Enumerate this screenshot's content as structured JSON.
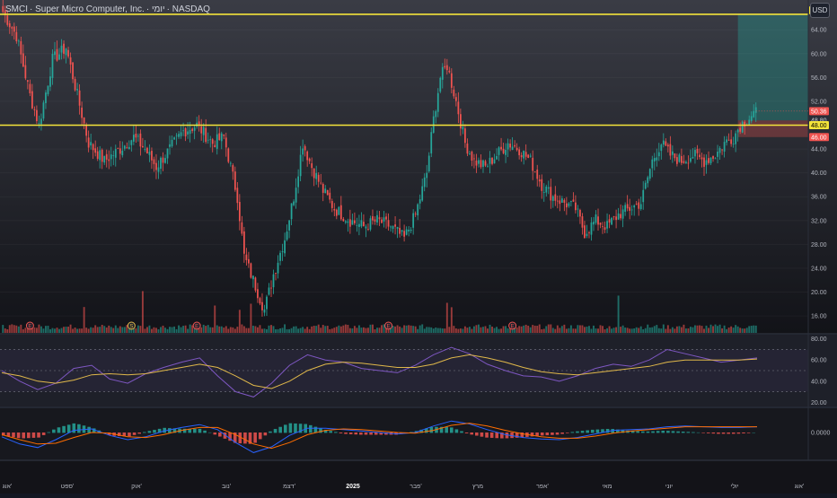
{
  "header": {
    "symbol": "SMCI",
    "company": "Super Micro Computer, Inc.",
    "interval": "יומי",
    "exchange": "NASDAQ",
    "currency_button": "USD"
  },
  "colors": {
    "background": "#131722",
    "up": "#26a69a",
    "down": "#ef5350",
    "level_line": "#f4e43a",
    "rsi_line": "#7e57c2",
    "rsi_ma": "#e0b84a",
    "macd_line": "#2962ff",
    "signal_line": "#ff6d00"
  },
  "chart_data": [
    {
      "type": "candlestick",
      "panel": "price",
      "y_ticks": [
        "64.00",
        "60.00",
        "56.00",
        "52.00",
        "44.00",
        "40.00",
        "36.00",
        "32.00",
        "28.00",
        "24.00",
        "20.00",
        "16.00"
      ],
      "ylim": [
        13,
        69
      ],
      "x_tick_labels": [
        "אוג'",
        "ספט'",
        "אוק'",
        "נוב'",
        "דצמ'",
        "2025",
        "פבר'",
        "מרץ",
        "אפר'",
        "מאי",
        "יוני",
        "יולי",
        "אוג'"
      ],
      "level_lines": [
        {
          "price": 66.6,
          "label": "66.60"
        },
        {
          "price": 48.0,
          "label": "48.00"
        }
      ],
      "price_badges": [
        {
          "label": "66.60",
          "price": 66.6
        },
        {
          "label": "50.36",
          "price": 50.36
        },
        {
          "label": "48.80",
          "price": 48.8
        },
        {
          "label": "48.00",
          "price": 48.0
        },
        {
          "label": "46.00",
          "price": 46.0
        }
      ],
      "position_tool": {
        "entry": 48.8,
        "target": 66.6,
        "stop": 46.0
      },
      "event_markers": [
        "E",
        "S",
        "E",
        "E",
        "E"
      ],
      "close_path": [
        [
          0,
          67
        ],
        [
          6,
          63
        ],
        [
          12,
          53
        ],
        [
          16,
          48
        ],
        [
          22,
          59
        ],
        [
          28,
          61
        ],
        [
          33,
          53
        ],
        [
          38,
          45
        ],
        [
          45,
          42
        ],
        [
          52,
          44
        ],
        [
          58,
          46
        ],
        [
          63,
          44
        ],
        [
          68,
          41
        ],
        [
          74,
          44
        ],
        [
          80,
          47
        ],
        [
          86,
          48
        ],
        [
          93,
          45
        ],
        [
          98,
          46
        ],
        [
          104,
          36
        ],
        [
          107,
          26
        ],
        [
          111,
          22
        ],
        [
          116,
          17
        ],
        [
          120,
          23
        ],
        [
          125,
          29
        ],
        [
          129,
          36
        ],
        [
          133,
          45
        ],
        [
          137,
          41
        ],
        [
          142,
          37
        ],
        [
          147,
          34
        ],
        [
          154,
          32
        ],
        [
          160,
          31
        ],
        [
          166,
          32
        ],
        [
          172,
          31
        ],
        [
          178,
          29
        ],
        [
          183,
          33
        ],
        [
          188,
          40
        ],
        [
          191,
          49
        ],
        [
          194,
          56
        ],
        [
          197,
          58
        ],
        [
          201,
          52
        ],
        [
          205,
          45
        ],
        [
          209,
          42
        ],
        [
          214,
          41
        ],
        [
          219,
          43
        ],
        [
          224,
          45
        ],
        [
          229,
          44
        ],
        [
          234,
          42
        ],
        [
          239,
          38
        ],
        [
          244,
          36
        ],
        [
          249,
          35
        ],
        [
          254,
          34
        ],
        [
          258,
          30
        ],
        [
          263,
          32
        ],
        [
          268,
          31
        ],
        [
          273,
          33
        ],
        [
          278,
          34
        ],
        [
          283,
          35
        ],
        [
          288,
          42
        ],
        [
          292,
          45
        ],
        [
          296,
          43
        ],
        [
          301,
          42
        ],
        [
          306,
          43
        ],
        [
          311,
          42
        ],
        [
          316,
          43
        ],
        [
          320,
          45
        ],
        [
          324,
          46
        ],
        [
          327,
          48
        ],
        [
          330,
          49
        ],
        [
          333,
          50
        ]
      ],
      "volume_note": "relative volume bars"
    },
    {
      "type": "line",
      "panel": "RSI",
      "y_ticks": [
        "80.00",
        "60.00",
        "40.00",
        "20.00"
      ],
      "ylim": [
        16,
        84
      ],
      "series": [
        {
          "role": "rsi",
          "values": [
            50,
            40,
            32,
            38,
            52,
            55,
            42,
            38,
            47,
            53,
            58,
            62,
            45,
            30,
            25,
            38,
            55,
            65,
            60,
            58,
            52,
            50,
            48,
            55,
            65,
            72,
            66,
            56,
            50,
            45,
            44,
            40,
            45,
            52,
            56,
            54,
            60,
            70,
            66,
            62,
            58,
            60,
            62
          ]
        },
        {
          "role": "rsi-ma",
          "values": [
            48,
            45,
            40,
            38,
            41,
            46,
            47,
            46,
            47,
            50,
            53,
            56,
            53,
            45,
            36,
            33,
            40,
            50,
            56,
            58,
            57,
            55,
            53,
            53,
            56,
            62,
            65,
            62,
            58,
            53,
            49,
            47,
            46,
            48,
            50,
            52,
            54,
            58,
            60,
            60,
            60,
            60,
            61
          ]
        }
      ]
    },
    {
      "type": "bar+line",
      "panel": "MACD",
      "y_ticks": [
        "0.0000"
      ],
      "series": [
        {
          "role": "macd",
          "values": [
            -0.6,
            -1.6,
            -2.1,
            -1.0,
            0.3,
            0.5,
            -0.4,
            -1.0,
            -0.6,
            0.2,
            0.7,
            1.1,
            0.4,
            -1.4,
            -2.8,
            -2.0,
            -0.4,
            0.6,
            0.6,
            0.4,
            0.2,
            0.0,
            -0.2,
            0.0,
            0.9,
            1.6,
            1.2,
            0.4,
            -0.3,
            -0.7,
            -0.9,
            -1.0,
            -0.7,
            -0.2,
            0.3,
            0.4,
            0.5,
            0.8,
            0.9,
            0.8,
            0.7,
            0.7,
            0.8
          ]
        },
        {
          "role": "signal",
          "values": [
            -0.3,
            -1.0,
            -1.6,
            -1.5,
            -0.7,
            0.0,
            -0.1,
            -0.6,
            -0.7,
            -0.3,
            0.3,
            0.7,
            0.7,
            -0.3,
            -1.6,
            -2.2,
            -1.4,
            -0.3,
            0.3,
            0.5,
            0.4,
            0.2,
            0.0,
            -0.1,
            0.3,
            1.0,
            1.3,
            0.9,
            0.3,
            -0.2,
            -0.6,
            -0.8,
            -0.8,
            -0.5,
            -0.1,
            0.2,
            0.4,
            0.6,
            0.8,
            0.8,
            0.8,
            0.8,
            0.8
          ]
        }
      ]
    }
  ]
}
